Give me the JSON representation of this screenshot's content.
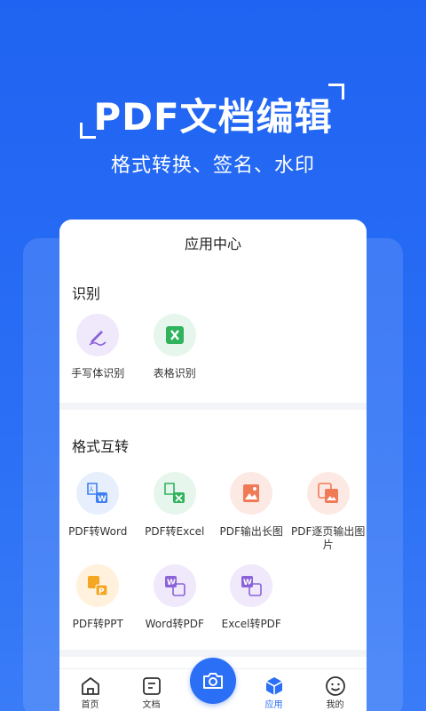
{
  "hero": {
    "title": "PDF文档编辑",
    "subtitle": "格式转换、签名、水印"
  },
  "card": {
    "title": "应用中心"
  },
  "sections": {
    "recognition": {
      "title": "识别",
      "items": [
        {
          "label": "手写体识别",
          "icon": "handwriting-pen-icon"
        },
        {
          "label": "表格识别",
          "icon": "excel-table-icon"
        }
      ]
    },
    "convert": {
      "title": "格式互转",
      "items": [
        {
          "label": "PDF转Word",
          "icon": "pdf-to-word-icon"
        },
        {
          "label": "PDF转Excel",
          "icon": "pdf-to-excel-icon"
        },
        {
          "label": "PDF输出长图",
          "icon": "pdf-long-image-icon"
        },
        {
          "label": "PDF逐页输出图片",
          "icon": "pdf-page-images-icon"
        },
        {
          "label": "PDF转PPT",
          "icon": "pdf-to-ppt-icon"
        },
        {
          "label": "Word转PDF",
          "icon": "word-to-pdf-icon"
        },
        {
          "label": "Excel转PDF",
          "icon": "excel-to-pdf-icon"
        }
      ]
    }
  },
  "nav": {
    "items": [
      {
        "label": "首页",
        "icon": "home-icon",
        "active": false
      },
      {
        "label": "文档",
        "icon": "document-icon",
        "active": false
      },
      {
        "label": "应用",
        "icon": "apps-cube-icon",
        "active": true
      },
      {
        "label": "我的",
        "icon": "smiley-profile-icon",
        "active": false
      }
    ],
    "camera": "camera-icon"
  },
  "colors": {
    "primary": "#2a6ff5",
    "background": "#1f63f2",
    "card": "#ffffff",
    "divider": "#f3f4f7"
  }
}
